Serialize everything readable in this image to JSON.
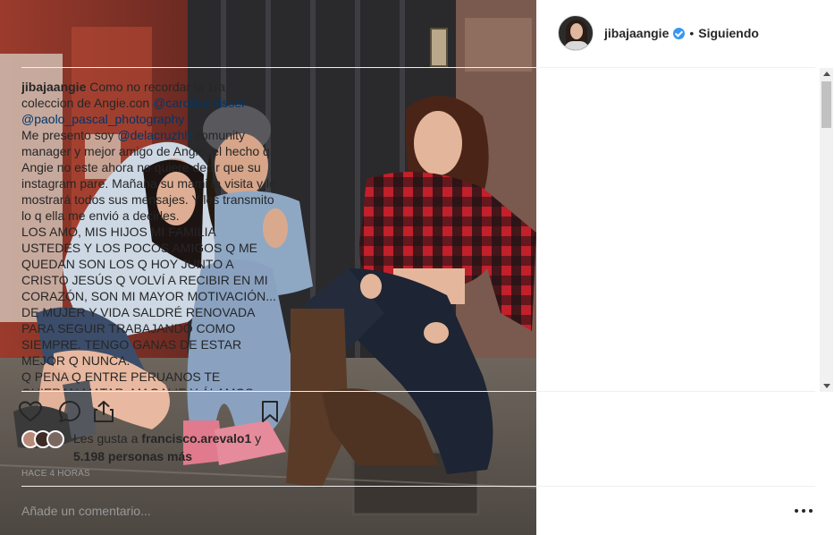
{
  "post": {
    "username": "jibajaangie",
    "separator": "•",
    "follow_label": "Siguiendo",
    "caption": {
      "author": "jibajaangie",
      "segments": [
        {
          "t": "text",
          "v": " Como no recordar la 1ra coleccion de Angie.con "
        },
        {
          "t": "mention",
          "v": "@caroline.visser"
        },
        {
          "t": "text",
          "v": " "
        },
        {
          "t": "mention",
          "v": "@paolo_pascal_photography"
        },
        {
          "t": "text",
          "v": "\nMe presento soy "
        },
        {
          "t": "mention",
          "v": "@delacruzhh"
        },
        {
          "t": "text",
          "v": " comunity manager y mejor amigo de Angie, el hecho q Angie no este ahora no quiere decir que su instagram pare. Mañana su mami la visita y le mostrará todos sus mensajes. Y les transmito lo q ella me envió a decirles.\nLOS AMO, MIS HIJOS MI FAMILIA USTEDES Y LOS POCOS AMIGOS Q ME QUEDAN SON LOS Q HOY JUNTO A CRISTO JESÚS Q VOLVÍ A RECIBIR EN MI CORAZÓN, SON MI MAYOR MOTIVACIÓN... DE MUJER Y VIDA SALDRÉ RENOVADA PARA SEGUIR TRABAJANDO COMO SIEMPRE. TENGO GANAS DE ESTAR MEJOR Q NUNCA.\nQ PENA Q ENTRE PERUANOS TE QUIERAN MATAR. MAGALIE Y ÁLAMOS PÉREZ LUNAS TREMENDAS JOYAS FUERON MUY BÁSICOS"
        }
      ]
    },
    "likes": {
      "prefix": "Les gusta a ",
      "user": "francisco.arevalo1",
      "middle": " y ",
      "count": "5.198 personas más"
    },
    "time_ago": "HACE 4 HORAS",
    "comment_placeholder": "Añade un comentario...",
    "icons": {
      "like": "heart-icon",
      "comment": "comment-bubble-icon",
      "share": "share-icon",
      "save": "bookmark-icon",
      "more": "more-options-icon",
      "verified": "verified-badge-icon"
    },
    "colors": {
      "mention": "#003569",
      "verified": "#3897f0",
      "muted": "#999999",
      "text": "#262626"
    }
  }
}
